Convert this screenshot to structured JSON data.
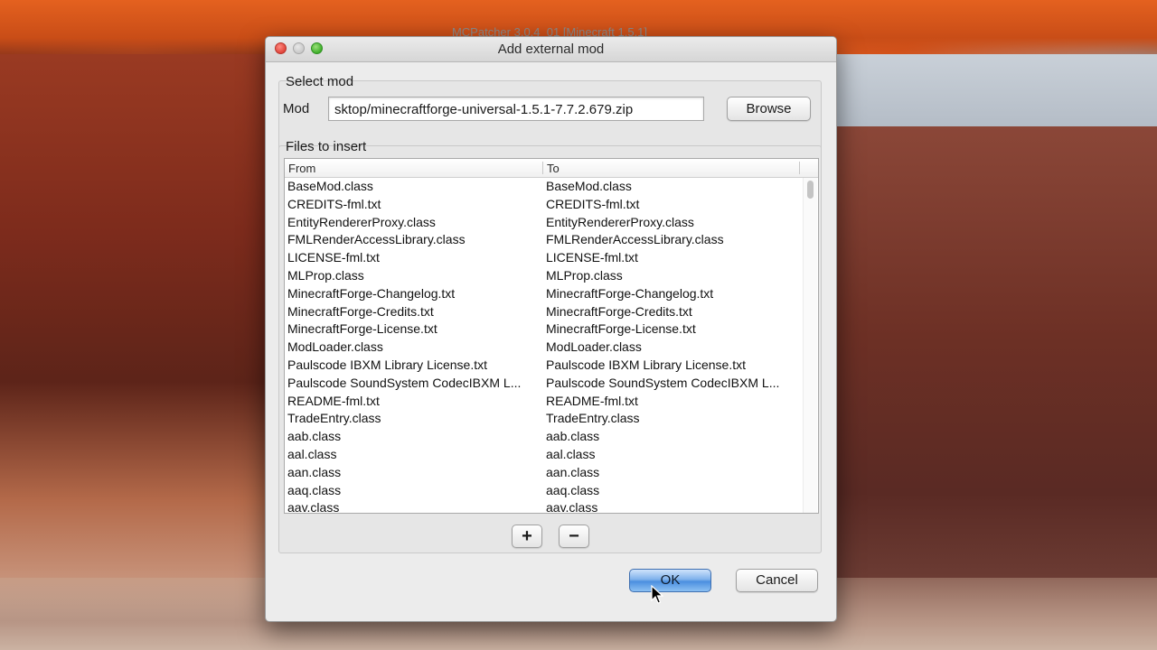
{
  "background_window": {
    "title": "MCPatcher 3.0.4_01 [Minecraft 1.5.1]"
  },
  "dialog": {
    "title": "Add external mod",
    "select_mod": {
      "group_label": "Select mod",
      "mod_label": "Mod",
      "mod_value": "sktop/minecraftforge-universal-1.5.1-7.7.2.679.zip",
      "browse_label": "Browse"
    },
    "files": {
      "group_label": "Files to insert",
      "columns": {
        "from": "From",
        "to": "To"
      },
      "rows": [
        {
          "from": "BaseMod.class",
          "to": "BaseMod.class"
        },
        {
          "from": "CREDITS-fml.txt",
          "to": "CREDITS-fml.txt"
        },
        {
          "from": "EntityRendererProxy.class",
          "to": "EntityRendererProxy.class"
        },
        {
          "from": "FMLRenderAccessLibrary.class",
          "to": "FMLRenderAccessLibrary.class"
        },
        {
          "from": "LICENSE-fml.txt",
          "to": "LICENSE-fml.txt"
        },
        {
          "from": "MLProp.class",
          "to": "MLProp.class"
        },
        {
          "from": "MinecraftForge-Changelog.txt",
          "to": "MinecraftForge-Changelog.txt"
        },
        {
          "from": "MinecraftForge-Credits.txt",
          "to": "MinecraftForge-Credits.txt"
        },
        {
          "from": "MinecraftForge-License.txt",
          "to": "MinecraftForge-License.txt"
        },
        {
          "from": "ModLoader.class",
          "to": "ModLoader.class"
        },
        {
          "from": "Paulscode IBXM Library License.txt",
          "to": "Paulscode IBXM Library License.txt"
        },
        {
          "from": "Paulscode SoundSystem CodecIBXM L...",
          "to": "Paulscode SoundSystem CodecIBXM L..."
        },
        {
          "from": "README-fml.txt",
          "to": "README-fml.txt"
        },
        {
          "from": "TradeEntry.class",
          "to": "TradeEntry.class"
        },
        {
          "from": "aab.class",
          "to": "aab.class"
        },
        {
          "from": "aal.class",
          "to": "aal.class"
        },
        {
          "from": "aan.class",
          "to": "aan.class"
        },
        {
          "from": "aaq.class",
          "to": "aaq.class"
        },
        {
          "from": "aav.class",
          "to": "aav.class"
        }
      ],
      "add_label": "+",
      "remove_label": "−"
    },
    "ok_label": "OK",
    "cancel_label": "Cancel"
  },
  "icons": [
    "close-icon",
    "minimize-icon",
    "maximize-icon",
    "plus-icon",
    "minus-icon",
    "mouse-cursor-icon"
  ],
  "colors": {
    "ok_accent": "#4b8fe0",
    "close": "#e0443a",
    "maximize": "#3faf2a"
  }
}
